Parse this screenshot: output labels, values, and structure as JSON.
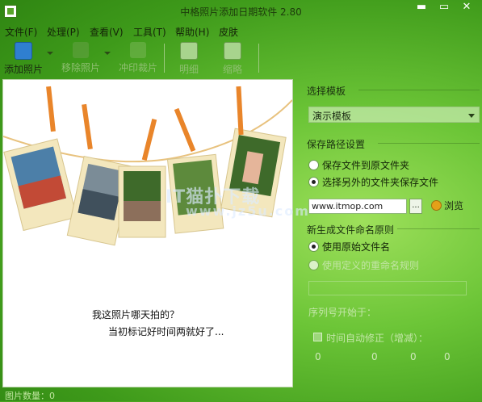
{
  "window": {
    "title": "中格照片添加日期软件 2.80",
    "min": "▬",
    "max": "▭",
    "close": "✕"
  },
  "menu": [
    {
      "label": "文件(F)"
    },
    {
      "label": "处理(P)"
    },
    {
      "label": "查看(V)"
    },
    {
      "label": "工具(T)"
    },
    {
      "label": "帮助(H)"
    },
    {
      "label": "皮肤"
    }
  ],
  "toolbar": {
    "add": "添加照片",
    "remove": "移除照片",
    "crop": "冲印裁片",
    "detail": "明细",
    "thumb": "缩略"
  },
  "preview": {
    "line1": "我这照片哪天拍的？",
    "line2": "当初标记好时间两就好了..."
  },
  "template": {
    "section_title": "选择模板",
    "selected": "演示模板"
  },
  "save_path": {
    "section_title": "保存路径设置",
    "option1": "保存文件到原文件夹",
    "option2": "选择另外的文件夹保存文件",
    "path_value": "www.itmop.com",
    "dots": "...",
    "browse": "浏览"
  },
  "naming": {
    "section_title": "新生成文件命名原则",
    "option1": "使用原始文件名",
    "option2": "使用定义的重命名规则",
    "serial_label": "序列号开始于：",
    "time_fix": "时间自动修正（增减）：",
    "spin_values": [
      "0",
      "0",
      "0",
      "0"
    ]
  },
  "status": {
    "text": "图片数量：0"
  },
  "watermark": {
    "line1": "IT猫扑下载",
    "line2": "www.jz5u.com"
  },
  "colors": {
    "accent": "#4aa51f",
    "rope": "#f0a050"
  }
}
